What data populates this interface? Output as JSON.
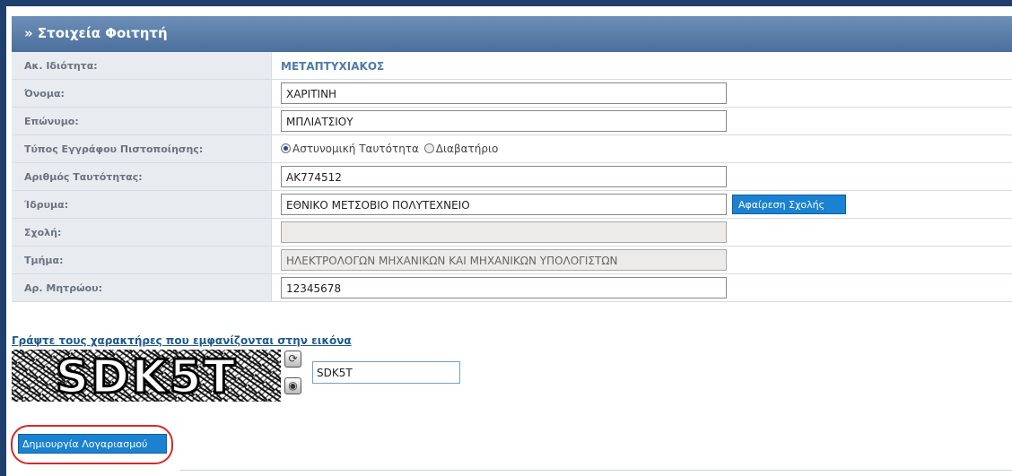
{
  "panel": {
    "title": "» Στοιχεία Φοιτητή"
  },
  "form": {
    "academic_status": {
      "label": "Ακ. Ιδιότητα:",
      "value": "ΜΕΤΑΠΤΥΧΙΑΚΟΣ"
    },
    "first_name": {
      "label": "Όνομα:",
      "value": "ΧΑΡΙΤΙΝΗ"
    },
    "last_name": {
      "label": "Επώνυμο:",
      "value": "ΜΠΛΙΑΤΣΙΟΥ"
    },
    "doc_type": {
      "label": "Τύπος Εγγράφου Πιστοποίησης:",
      "options": [
        "Αστυνομική Ταυτότητα",
        "Διαβατήριο"
      ],
      "selected": "Αστυνομική Ταυτότητα"
    },
    "id_number": {
      "label": "Αριθμός Ταυτότητας:",
      "value": "ΑΚ774512"
    },
    "institution": {
      "label": "Ίδρυμα:",
      "value": "ΕΘΝΙΚΟ ΜΕΤΣΟΒΙΟ ΠΟΛΥΤΕΧΝΕΙΟ",
      "remove_button": "Αφαίρεση Σχολής"
    },
    "school": {
      "label": "Σχολή:",
      "value": ""
    },
    "department": {
      "label": "Τμήμα:",
      "value": "ΗΛΕΚΤΡΟΛΟΓΩΝ ΜΗΧΑΝΙΚΩΝ ΚΑΙ ΜΗΧΑΝΙΚΩΝ ΥΠΟΛΟΓΙΣΤΩΝ"
    },
    "registry_number": {
      "label": "Αρ. Μητρώου:",
      "value": "12345678"
    }
  },
  "captcha": {
    "prompt": "Γράψτε τους χαρακτήρες που εμφανίζονται στην εικόνα",
    "image_text": "SDK5T",
    "input_value": "SDK5T",
    "refresh_icon": "refresh-icon",
    "audio_icon": "audio-icon"
  },
  "actions": {
    "create_account": "Δημιουργία Λογαριασμού"
  },
  "colors": {
    "header": "#4b6f9c",
    "button": "#1a82d0",
    "highlight": "#d42b2b",
    "value_text": "#4e7aa8"
  }
}
